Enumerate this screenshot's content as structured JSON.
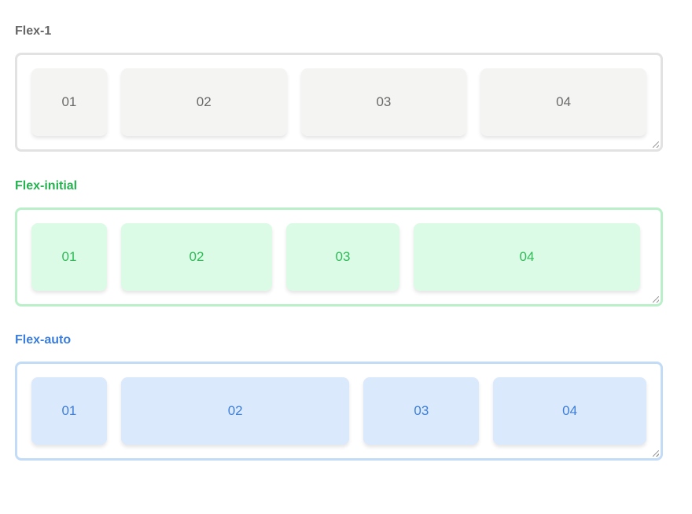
{
  "sections": [
    {
      "title": "Flex-1",
      "items": [
        "01",
        "02",
        "03",
        "04"
      ],
      "colors": {
        "title": "#666666",
        "border": "#e2e2e2",
        "item_bg": "#f4f4f3",
        "item_text": "#6b6b6b"
      }
    },
    {
      "title": "Flex-initial",
      "items": [
        "01",
        "02",
        "03",
        "04"
      ],
      "colors": {
        "title": "#24b34f",
        "border": "#b9f0c9",
        "item_bg": "#dcfbe7",
        "item_text": "#2ebc56"
      }
    },
    {
      "title": "Flex-auto",
      "items": [
        "01",
        "02",
        "03",
        "04"
      ],
      "colors": {
        "title": "#3b7ddc",
        "border": "#c2dbf7",
        "item_bg": "#dbe9fd",
        "item_text": "#3d7fd8"
      }
    }
  ],
  "icons": {
    "resize": "resize-grip-icon"
  }
}
